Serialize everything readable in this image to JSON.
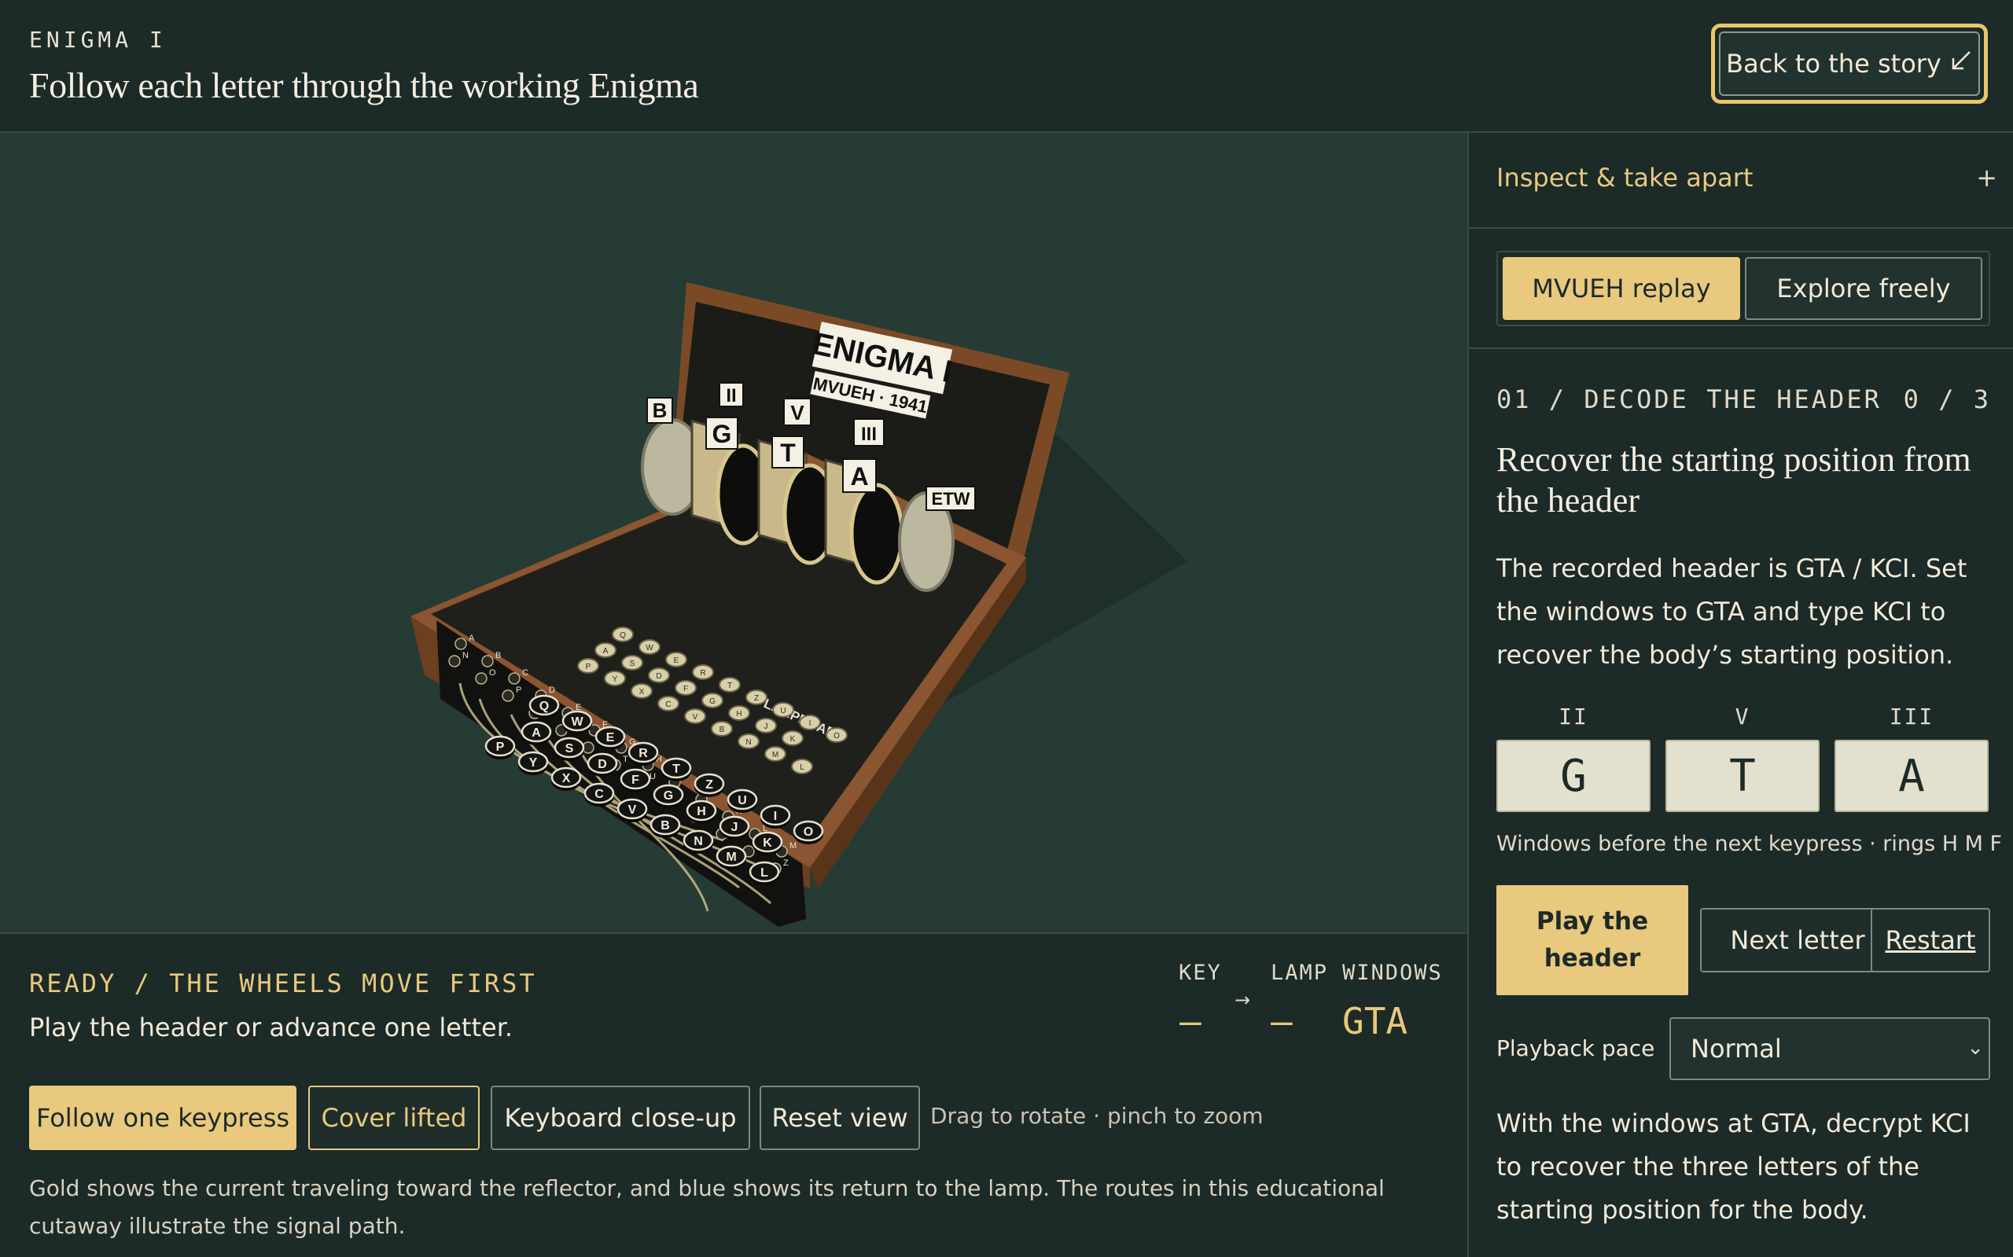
{
  "header": {
    "kicker": "ENIGMA I",
    "title": "Follow each letter through the working Enigma",
    "back_label": "Back to the story",
    "back_icon": "arrow-down-left-icon"
  },
  "machine": {
    "title": "ENIGMA I",
    "subtitle": "MVUEH · 1941",
    "rotor_labels": {
      "reflector": "B",
      "left_type": "II",
      "left_letter": "G",
      "mid_type": "V",
      "mid_letter": "T",
      "right_type": "III",
      "right_letter": "A",
      "entry": "ETW"
    },
    "lampboard_label": "LAMPBOARD",
    "keyboard_rows": [
      [
        "Q",
        "W",
        "E",
        "R",
        "T",
        "Z",
        "U",
        "I",
        "O"
      ],
      [
        "A",
        "S",
        "D",
        "F",
        "G",
        "H",
        "J",
        "K"
      ],
      [
        "P",
        "Y",
        "X",
        "C",
        "V",
        "B",
        "N",
        "M",
        "L"
      ]
    ],
    "plugboard": [
      "A",
      "B",
      "C",
      "D",
      "E",
      "F",
      "G",
      "H",
      "I",
      "J",
      "K",
      "L",
      "M",
      "N",
      "O",
      "P",
      "Q",
      "R",
      "S",
      "T",
      "U",
      "V",
      "W",
      "X",
      "Y",
      "Z"
    ]
  },
  "status": {
    "title": "READY / THE WHEELS MOVE FIRST",
    "subtitle": "Play the header or advance one letter.",
    "key_label": "KEY",
    "key_value": "–",
    "arrow": "→",
    "lamp_label": "LAMP",
    "lamp_value": "–",
    "windows_label": "WINDOWS",
    "windows_value": "GTA"
  },
  "view_buttons": [
    "Follow one keypress",
    "Cover lifted",
    "Keyboard close-up",
    "Reset view"
  ],
  "hint": "Drag to rotate · pinch to zoom",
  "legend": "Gold shows the current traveling toward the reflector, and blue shows its return to the lamp. The routes in this educational cutaway illustrate the signal path.",
  "side": {
    "inspect_label": "Inspect & take apart",
    "inspect_icon": "+",
    "modes": [
      "MVUEH replay",
      "Explore freely"
    ],
    "step_label": "01 / DECODE THE HEADER",
    "step_count": "0 / 3",
    "step_title": "Recover the starting position from the header",
    "step_desc": "The recorded header is GTA / KCI. Set the windows to GTA and type KCI to recover the body’s starting position.",
    "windows": [
      {
        "rotor": "II",
        "letter": "G"
      },
      {
        "rotor": "V",
        "letter": "T"
      },
      {
        "rotor": "III",
        "letter": "A"
      }
    ],
    "windows_note": "Windows before the next keypress · rings H M F",
    "play_label": "Play the header",
    "next_label": "Next letter",
    "restart_label": "Restart",
    "pace_label": "Playback pace",
    "pace_value": "Normal",
    "pace_note": "With the windows at GTA, decrypt KCI to recover the three letters of the starting position for the body."
  },
  "colors": {
    "accent": "#e8c97d",
    "focus_ring": "#e8c66b",
    "background": "#1c2a28",
    "viewer_bg": "#263b34",
    "wood": "#7a4a26"
  }
}
